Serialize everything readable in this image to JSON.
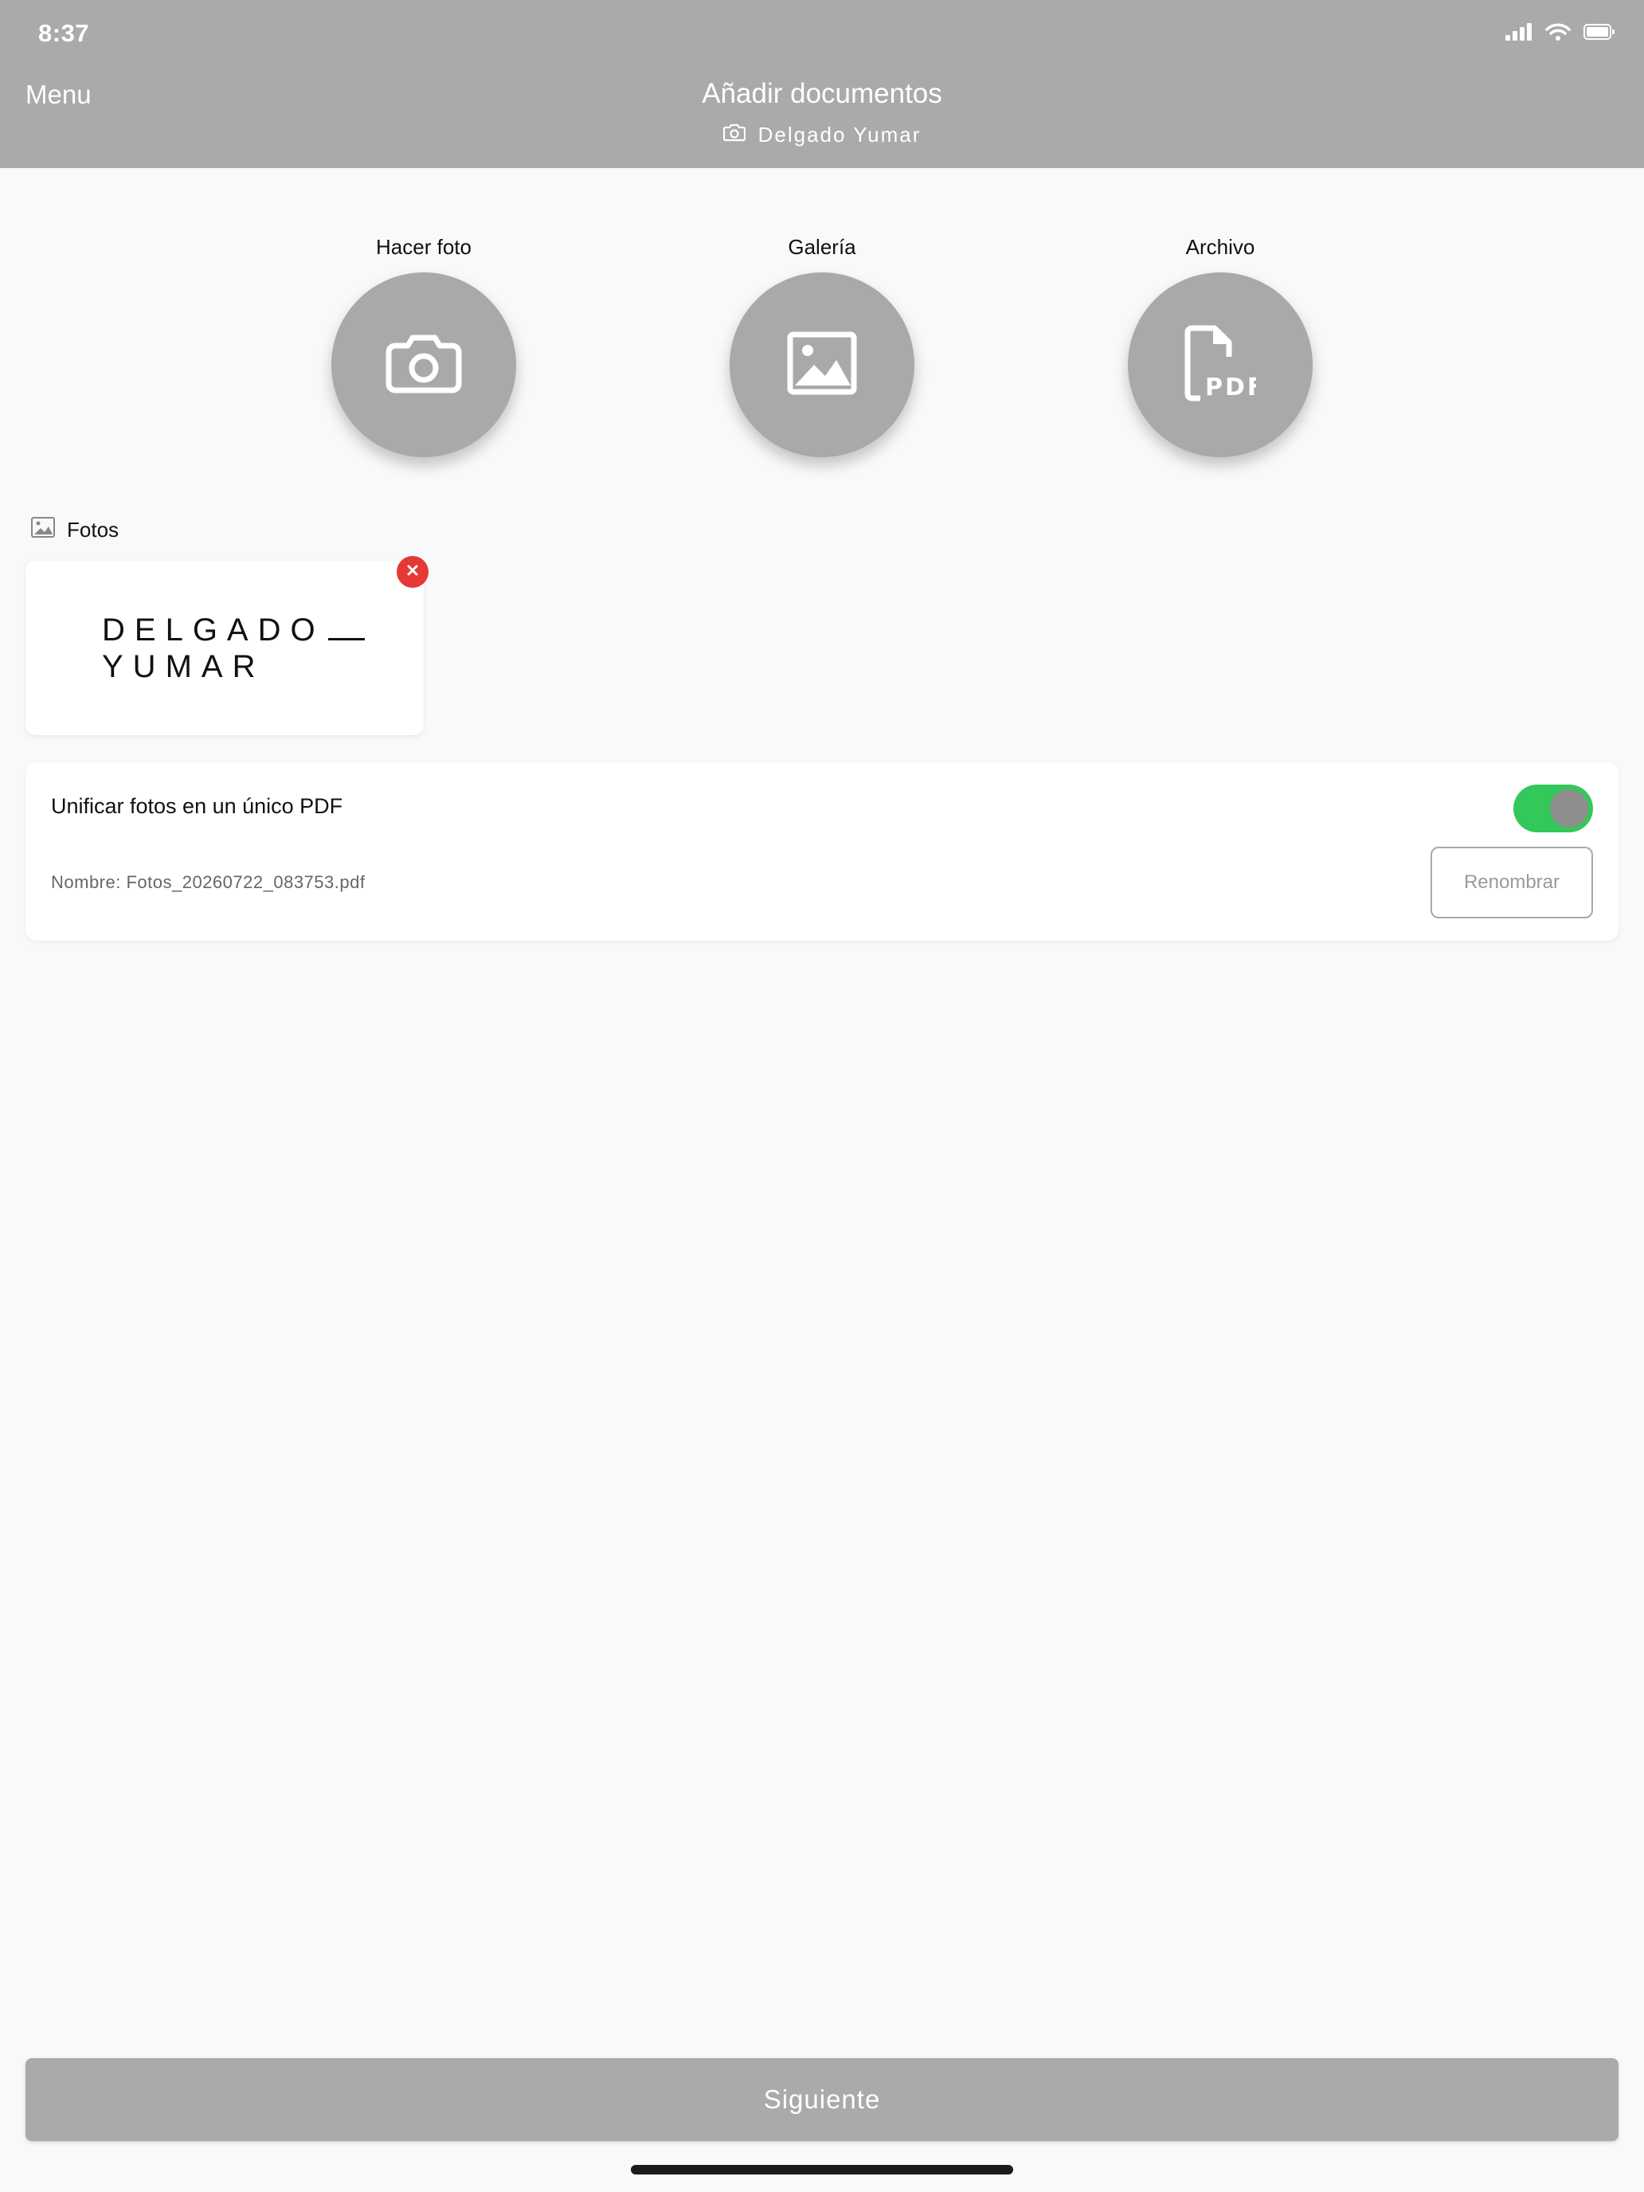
{
  "status_bar": {
    "time": "8:37"
  },
  "header": {
    "menu_label": "Menu",
    "title": "Añadir documentos",
    "subtitle": "Delgado Yumar"
  },
  "actions": [
    {
      "label": "Hacer foto",
      "icon": "camera-icon"
    },
    {
      "label": "Galería",
      "icon": "image-icon"
    },
    {
      "label": "Archivo",
      "icon": "pdf-file-icon"
    }
  ],
  "photos": {
    "section_label": "Fotos",
    "items": [
      {
        "line1": "DELGADO",
        "line2": "YUMAR"
      }
    ]
  },
  "unify": {
    "label": "Unificar fotos en un único PDF",
    "enabled": true,
    "file_name": "Nombre: Fotos_20260722_083753.pdf",
    "rename_label": "Renombrar"
  },
  "footer": {
    "next_label": "Siguiente"
  },
  "colors": {
    "header_bg": "#aaaaaa",
    "action_circle": "#a9a9a9",
    "toggle_on": "#34c759",
    "remove_badge": "#e53935",
    "page_bg": "#f8f9fb"
  }
}
